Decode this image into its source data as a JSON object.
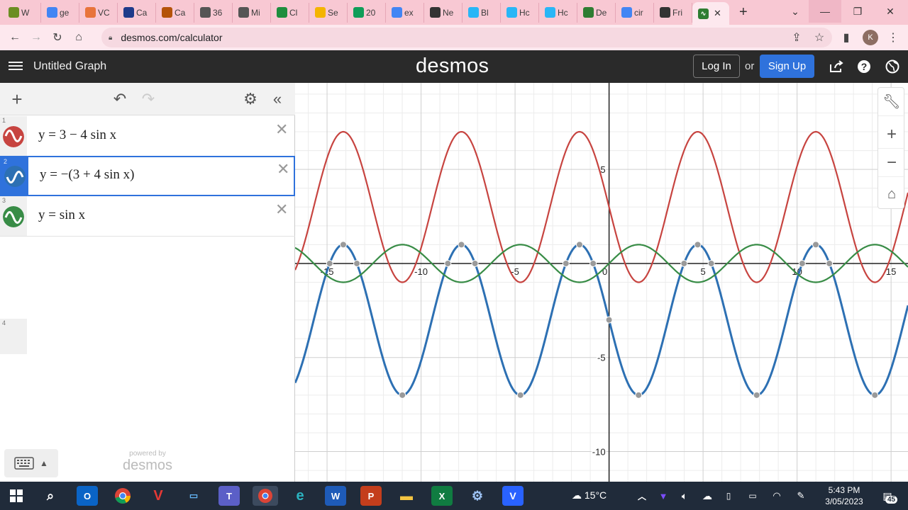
{
  "browser": {
    "tabs": [
      {
        "label": "W",
        "color": "#6b8e23"
      },
      {
        "label": "ge",
        "color": "#4285f4"
      },
      {
        "label": "VC",
        "color": "#e8743b"
      },
      {
        "label": "Ca",
        "color": "#1e3a8a"
      },
      {
        "label": "Ca",
        "color": "#b45309"
      },
      {
        "label": "36",
        "color": "#555555"
      },
      {
        "label": "Mi",
        "color": "#555555"
      },
      {
        "label": "Cl",
        "color": "#1e8e3e"
      },
      {
        "label": "Se",
        "color": "#f4b400"
      },
      {
        "label": "20",
        "color": "#0f9d58"
      },
      {
        "label": "ex",
        "color": "#4285f4"
      },
      {
        "label": "Ne",
        "color": "#333333"
      },
      {
        "label": "Bl",
        "color": "#29b6f6"
      },
      {
        "label": "Hc",
        "color": "#29b6f6"
      },
      {
        "label": "Hc",
        "color": "#29b6f6"
      },
      {
        "label": "De",
        "color": "#2e7d32"
      },
      {
        "label": "cir",
        "color": "#4285f4"
      },
      {
        "label": "Fri",
        "color": "#333333"
      }
    ],
    "active_tab_color": "#2e7d32",
    "url": "desmos.com/calculator",
    "profile_initial": "K"
  },
  "desmos": {
    "graph_title": "Untitled Graph",
    "logo": "desmos",
    "login_label": "Log In",
    "or_label": "or",
    "signup_label": "Sign Up",
    "powered_by": "powered by",
    "powered_logo": "desmos"
  },
  "expressions": [
    {
      "index": "1",
      "latex": "y = 3 − 4 sin x",
      "color": "#c74440"
    },
    {
      "index": "2",
      "latex": "y = −(3 + 4 sin x)",
      "color": "#2d70b3"
    },
    {
      "index": "3",
      "latex": "y = sin x",
      "color": "#388c46"
    },
    {
      "index": "4",
      "latex": "",
      "color": ""
    }
  ],
  "chart_data": {
    "type": "line",
    "xlim": [
      -16.7,
      15.9
    ],
    "ylim": [
      -11.6,
      9.6
    ],
    "x_ticks": [
      -15,
      -10,
      -5,
      0,
      5,
      10,
      15
    ],
    "y_ticks": [
      -10,
      -5,
      5
    ],
    "grid": true,
    "series": [
      {
        "name": "y = 3 − 4 sin x",
        "color": "#c74440",
        "expr": "3-4*sin(x)"
      },
      {
        "name": "y = −(3 + 4 sin x)",
        "color": "#2d70b3",
        "expr": "-(3+4*sin(x))"
      },
      {
        "name": "y = sin x",
        "color": "#388c46",
        "expr": "sin(x)"
      }
    ]
  },
  "taskbar": {
    "weather": "15°C",
    "time": "5:43 PM",
    "date": "3/05/2023",
    "notif_count": "45"
  }
}
